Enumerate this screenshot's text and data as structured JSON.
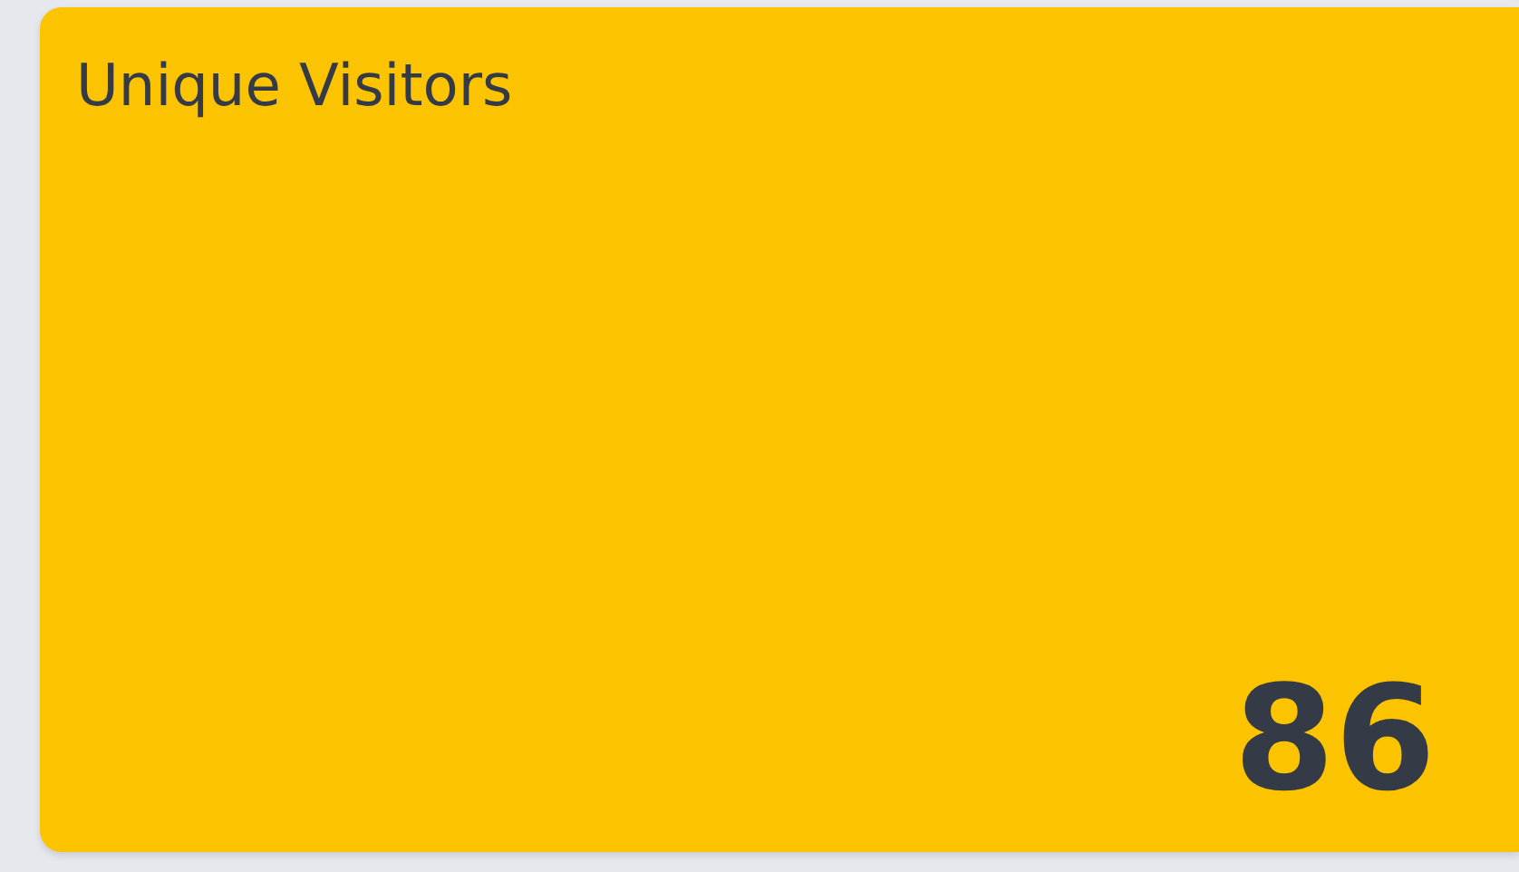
{
  "card": {
    "title": "Unique Visitors",
    "value": "86"
  }
}
